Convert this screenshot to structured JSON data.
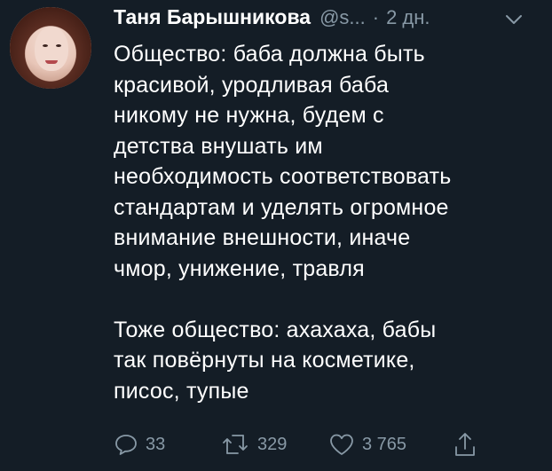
{
  "tweet": {
    "author": {
      "name": "Таня Барышникова",
      "handle": "@s...",
      "separator": "·",
      "time": "2 дн.",
      "avatar_icon": "user-avatar-photo"
    },
    "caret_icon": "chevron-down-icon",
    "paragraphs": [
      "Общество: баба должна быть\nкрасивой, уродливая баба\nникому не нужна, будем с\nдетства внушать им\nнеобходимость соответствовать\nстандартам и уделять огромное\nвнимание внешности, иначе\nчмор, унижение, травля",
      "Тоже общество: ахахаха, бабы\nтак повёрнуты на косметике,\nписос, тупые"
    ],
    "actions": {
      "reply": {
        "icon": "reply-bubble-icon",
        "count": "33"
      },
      "retweet": {
        "icon": "retweet-icon",
        "count": "329"
      },
      "like": {
        "icon": "heart-icon",
        "count": "3 765"
      },
      "share": {
        "icon": "share-icon"
      }
    },
    "colors": {
      "background": "#141d26",
      "text": "#ffffff",
      "secondary": "#8899a6"
    }
  }
}
